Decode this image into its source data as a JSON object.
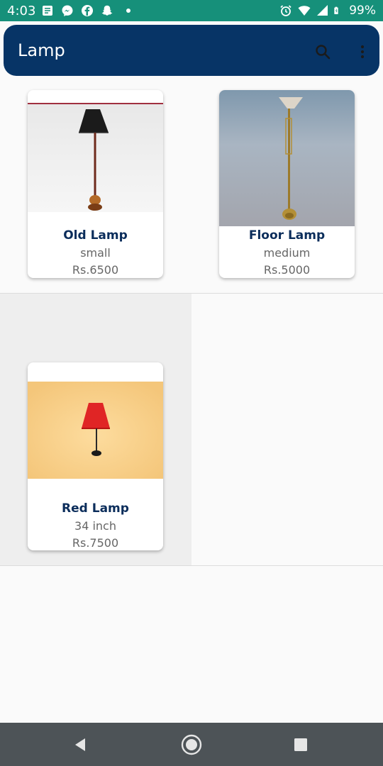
{
  "status_bar": {
    "time": "4:03",
    "battery": "99%",
    "icons": [
      "news-icon",
      "messenger-icon",
      "facebook-icon",
      "snapchat-icon",
      "alarm-icon",
      "wifi-icon",
      "signal-icon",
      "battery-icon"
    ]
  },
  "app_bar": {
    "title": "Lamp",
    "background": "#073466",
    "icons": [
      "search-icon",
      "more-vert-icon"
    ]
  },
  "products": [
    {
      "name": "Old Lamp",
      "size": "small",
      "price": "Rs.6500"
    },
    {
      "name": "Floor Lamp",
      "size": "medium",
      "price": "Rs.5000"
    },
    {
      "name": "Red Lamp",
      "size": "34 inch",
      "price": "Rs.7500"
    }
  ],
  "nav_bar": {
    "icons": [
      "back-icon",
      "home-icon",
      "recents-icon"
    ]
  }
}
